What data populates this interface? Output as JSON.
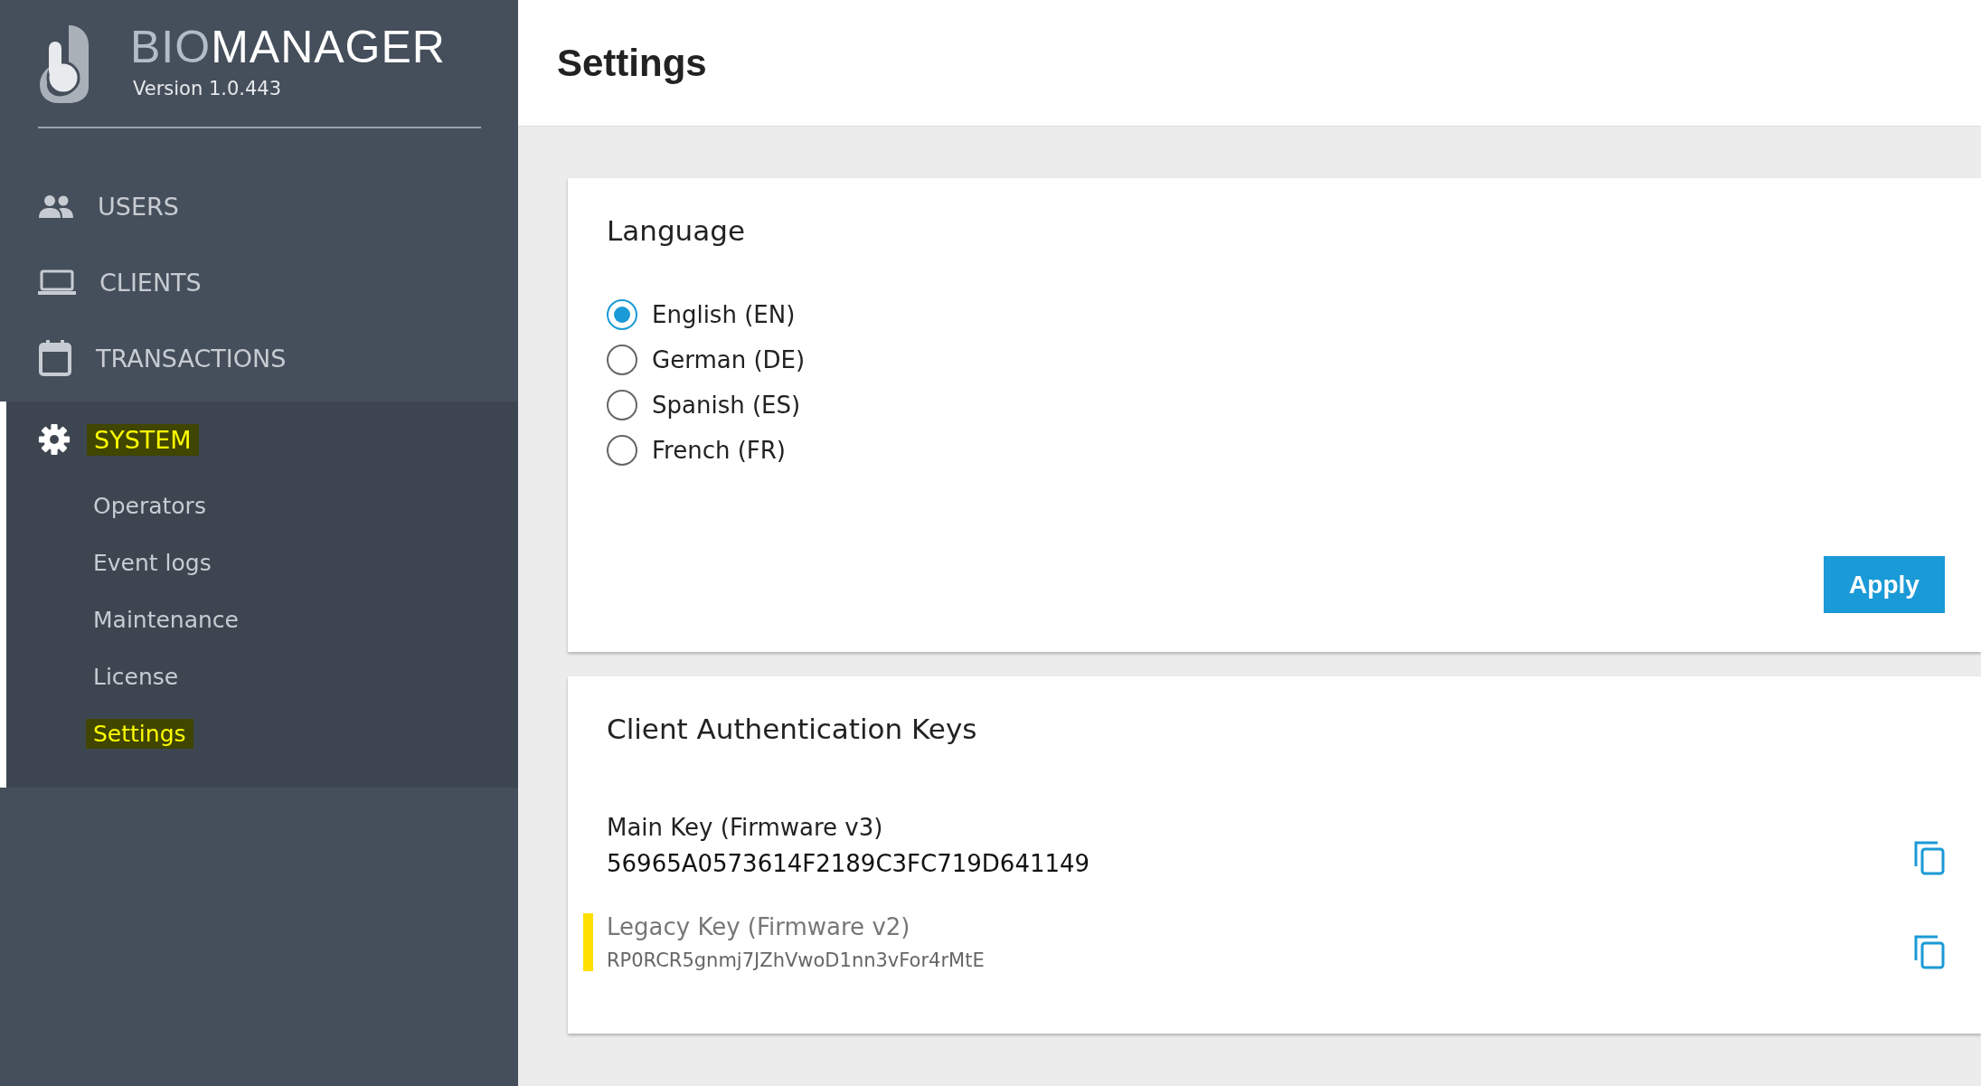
{
  "brand": {
    "prefix": "BIO",
    "name": "MANAGER",
    "version": "Version 1.0.443"
  },
  "nav": [
    {
      "kind": "users",
      "label": "USERS",
      "expanded": false,
      "highlighted": false
    },
    {
      "kind": "clients",
      "label": "CLIENTS",
      "expanded": false,
      "highlighted": false
    },
    {
      "kind": "transactions",
      "label": "TRANSACTIONS",
      "expanded": false,
      "highlighted": false
    },
    {
      "kind": "system",
      "label": "SYSTEM",
      "expanded": true,
      "highlighted": true,
      "children": [
        {
          "label": "Operators",
          "highlighted": false
        },
        {
          "label": "Event logs",
          "highlighted": false
        },
        {
          "label": "Maintenance",
          "highlighted": false
        },
        {
          "label": "License",
          "highlighted": false
        },
        {
          "label": "Settings",
          "highlighted": true
        }
      ]
    }
  ],
  "page_title": "Settings",
  "language": {
    "title": "Language",
    "options": [
      {
        "label": "English (EN)",
        "selected": true
      },
      {
        "label": "German (DE)",
        "selected": false
      },
      {
        "label": "Spanish (ES)",
        "selected": false
      },
      {
        "label": "French (FR)",
        "selected": false
      }
    ],
    "button": "Apply"
  },
  "keys": {
    "title": "Client Authentication Keys",
    "items": [
      {
        "kind": "main",
        "label": "Main Key (Firmware v3)",
        "value": "56965A0573614F2189C3FC719D641149",
        "highlighted": false
      },
      {
        "kind": "legacy",
        "label": "Legacy Key (Firmware v2)",
        "value": "RP0RCR5gnmj7JZhVwoD1nn3vFor4rMtE",
        "highlighted": true
      }
    ]
  }
}
